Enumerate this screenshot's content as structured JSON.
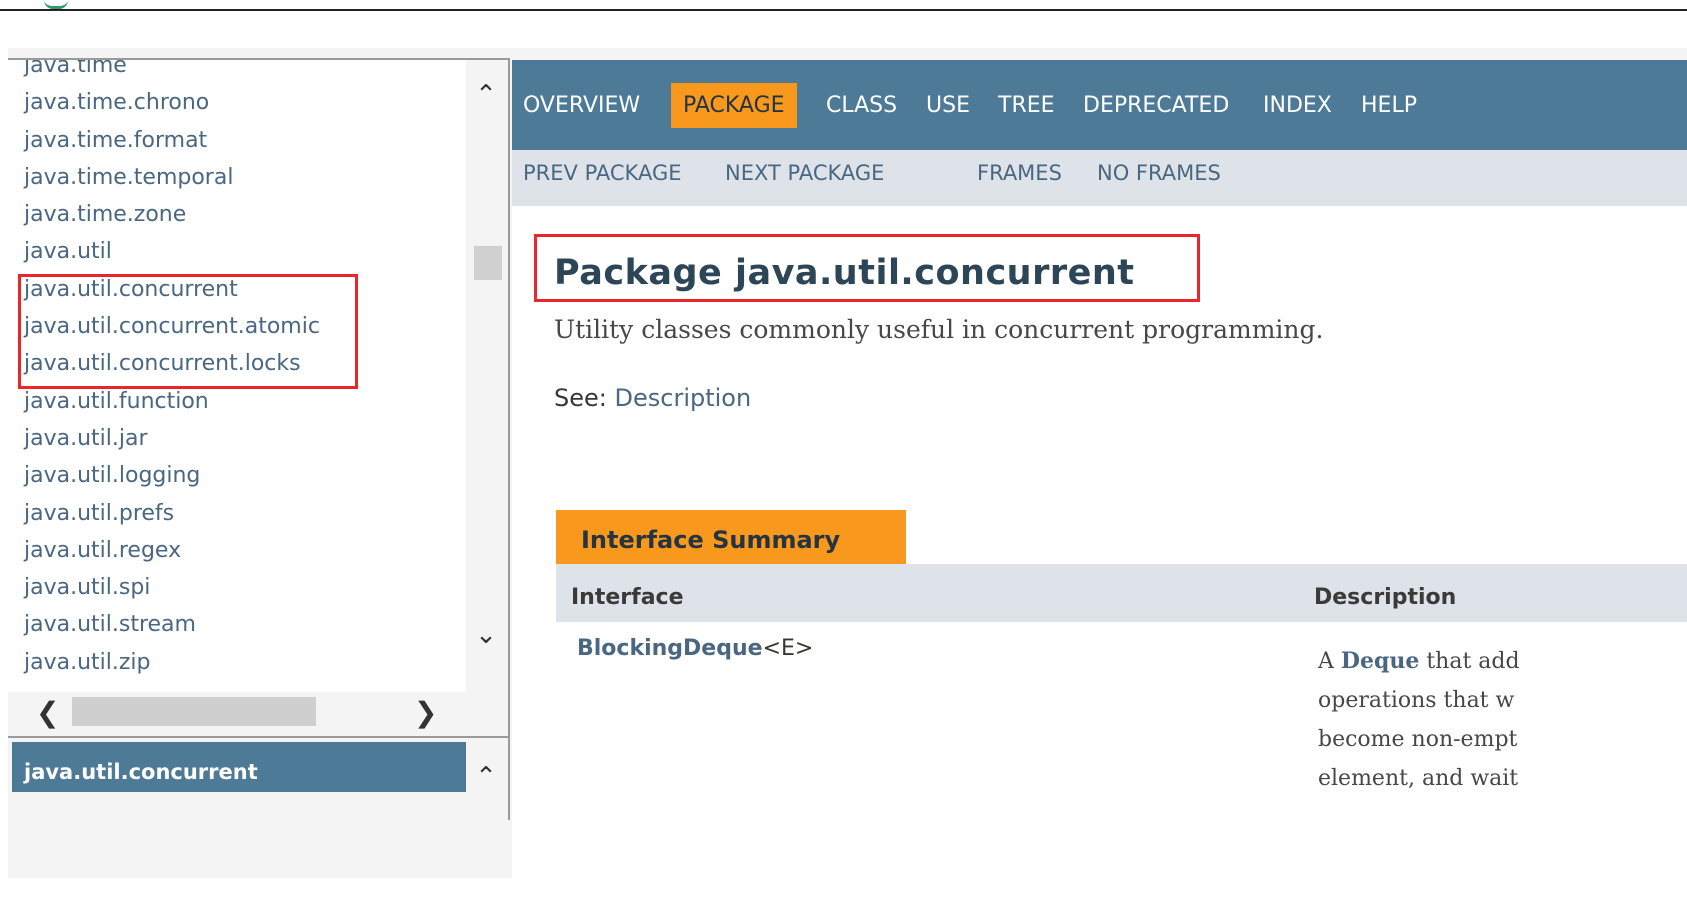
{
  "left": {
    "packages": [
      "java.time",
      "java.time.chrono",
      "java.time.format",
      "java.time.temporal",
      "java.time.zone",
      "java.util",
      "java.util.concurrent",
      "java.util.concurrent.atomic",
      "java.util.concurrent.locks",
      "java.util.function",
      "java.util.jar",
      "java.util.logging",
      "java.util.prefs",
      "java.util.regex",
      "java.util.spi",
      "java.util.stream",
      "java.util.zip"
    ],
    "current_package": "java.util.concurrent"
  },
  "nav": {
    "top": [
      "OVERVIEW",
      "PACKAGE",
      "CLASS",
      "USE",
      "TREE",
      "DEPRECATED",
      "INDEX",
      "HELP"
    ],
    "active": "PACKAGE",
    "sub": [
      "PREV PACKAGE",
      "NEXT PACKAGE",
      "FRAMES",
      "NO FRAMES"
    ]
  },
  "main": {
    "title": "Package java.util.concurrent",
    "description": "Utility classes commonly useful in concurrent programming.",
    "see_label": "See:",
    "see_link": "Description",
    "summary_tab": "Interface Summary",
    "columns": [
      "Interface",
      "Description"
    ],
    "rows": [
      {
        "name": "BlockingDeque",
        "generic": "<E>",
        "desc_lines": [
          "A |Deque| that add",
          "operations that w",
          "become non-empt",
          "element, and wait"
        ]
      }
    ]
  },
  "colors": {
    "nav_bg": "#4d7a97",
    "active_tab": "#f8981d",
    "subnav_bg": "#dee3e9",
    "link": "#4a6782",
    "highlight_box": "#e8262c"
  },
  "icons": [
    "chevron-up-icon",
    "chevron-down-icon",
    "chevron-left-icon",
    "chevron-right-icon"
  ]
}
